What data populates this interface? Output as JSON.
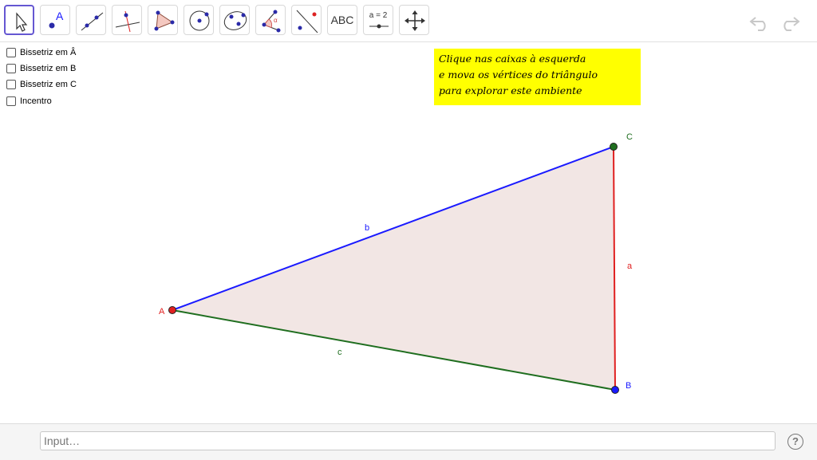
{
  "toolbar": {
    "tools": [
      {
        "name": "move",
        "icon": "cursor-arrow-icon"
      },
      {
        "name": "point",
        "icon": "point-icon",
        "label": "A"
      },
      {
        "name": "line",
        "icon": "line-icon"
      },
      {
        "name": "perpendicular-line",
        "icon": "perpendicular-line-icon"
      },
      {
        "name": "polygon",
        "icon": "polygon-icon"
      },
      {
        "name": "circle",
        "icon": "circle-icon"
      },
      {
        "name": "ellipse",
        "icon": "ellipse-icon"
      },
      {
        "name": "angle",
        "icon": "angle-icon",
        "label": "α"
      },
      {
        "name": "reflect",
        "icon": "reflect-icon"
      },
      {
        "name": "text",
        "icon": "text-icon",
        "label": "ABC"
      },
      {
        "name": "slider",
        "icon": "slider-icon",
        "label": "a = 2"
      },
      {
        "name": "move-graphics",
        "icon": "move-arrows-icon"
      }
    ],
    "undo": "undo-icon",
    "redo": "redo-icon"
  },
  "checkboxes": [
    {
      "label": "Bissetriz em Â",
      "checked": false
    },
    {
      "label": "Bissetriz em B",
      "checked": false
    },
    {
      "label": "Bissetriz em C",
      "checked": false
    },
    {
      "label": "Incentro",
      "checked": false
    }
  ],
  "note": {
    "lines": [
      "Clique nas caixas à esquerda",
      "e mova os vértices do triângulo",
      "para explorar este ambiente"
    ],
    "background": "#ffff00"
  },
  "triangle": {
    "vertices": {
      "A": "A",
      "B": "B",
      "C": "C"
    },
    "sides": {
      "a": "a",
      "b": "b",
      "c": "c"
    },
    "colors": {
      "A": "#e02020",
      "B": "#1a1aff",
      "C": "#1f6e1f",
      "side_a": "#e02020",
      "side_b": "#1a1aff",
      "side_c": "#1f6e1f",
      "fill": "#f2e6e4"
    }
  },
  "input": {
    "placeholder": "Input…"
  },
  "help": {
    "label": "?"
  }
}
